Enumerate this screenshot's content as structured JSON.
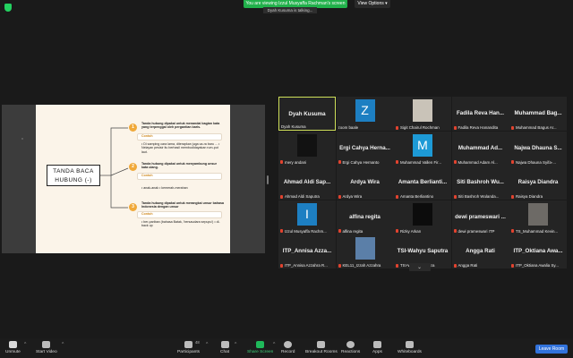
{
  "banner": {
    "viewing_text": "You are viewing Izzul Musyaffa Rachman's screen",
    "view_options": "View Options ▾",
    "talking": "Dyah Kusuma is talking..."
  },
  "slide": {
    "root_line1": "TANDA BACA",
    "root_line2": "HUBUNG (-)",
    "b1_num": "1",
    "b1_desc": "Tanda hubung dipakai untuk menandai bagian kata yang terpenggal oleh pergantian baris.",
    "b1_contoh": "Contoh",
    "b1_ex": "• Di samping cara lama, diterapkan juga ca-ra baru ...  • Nelayan pesisir itu berhasil membudidayakan rum-put laut.",
    "b2_num": "2",
    "b2_desc": "Tanda hubung dipakai untuk menyambung unsur kata ulang.",
    "b2_contoh": "Contoh",
    "b2_ex": "• anak-anak  • kemerah-merahan",
    "b3_num": "3",
    "b3_desc": "Tanda hubung dipakai untuk merangkai unsur bahasa Indonesia dengan unsur",
    "b3_contoh": "Contoh",
    "b3_ex": "• ber-pariban (bahasa Batak, 'bersaudara sepupu')  • di-back up"
  },
  "participants": [
    {
      "name": "Dyah Kusuma",
      "label": "Dyah Kusuma",
      "muted": false,
      "active": true
    },
    {
      "name": "",
      "label": "zoom baale",
      "muted": false,
      "avatar": "letter",
      "letter": "Z",
      "color": "#1d7fc2"
    },
    {
      "name": "",
      "label": "Sigit Chairul Rochman",
      "muted": true,
      "avatar": "photo",
      "color": "#c9c3b8"
    },
    {
      "name": "Fadila Reva Han...",
      "label": "Fadila Reva Hanandita",
      "muted": true
    },
    {
      "name": "Muhammad Bag...",
      "label": "Muhammad Bagus Ar...",
      "muted": true
    },
    {
      "name": "",
      "label": "mery andani",
      "muted": true,
      "avatar": "photo",
      "color": "#121212"
    },
    {
      "name": "Ergi Cahya Herna...",
      "label": "Ergi Cahya Hernanto",
      "muted": true
    },
    {
      "name": "",
      "label": "Muhammad Vallen Fir...",
      "muted": true,
      "avatar": "letter",
      "letter": "M",
      "color": "#1d9ad6"
    },
    {
      "name": "Muhammad Ad...",
      "label": "Muhammad Adam Al...",
      "muted": true
    },
    {
      "name": "Najwa Dhauna S...",
      "label": "Najwa Dhauna Syifa-...",
      "muted": true
    },
    {
      "name": "Ahmad Aldi Sap...",
      "label": "Ahmad Aldi Saputra",
      "muted": true
    },
    {
      "name": "Ardya Wira",
      "label": "Ardya Wira",
      "muted": true
    },
    {
      "name": "Amanta Berlianti...",
      "label": "Amanta Berliantino",
      "muted": true
    },
    {
      "name": "Siti Bashroh Wu...",
      "label": "Siti Bashroh Wulanda...",
      "muted": true
    },
    {
      "name": "Raisya Diandra",
      "label": "Raisya Diandra",
      "muted": true
    },
    {
      "name": "",
      "label": "Izzul Musyaffa Rachm...",
      "muted": true,
      "avatar": "letter",
      "letter": "I",
      "color": "#1d7fc2"
    },
    {
      "name": "alfina regita",
      "label": "alfina regita",
      "muted": true
    },
    {
      "name": "",
      "label": "Rizky Arkan",
      "muted": true,
      "avatar": "photo",
      "color": "#0c0c0c"
    },
    {
      "name": "dewi prameswari ...",
      "label": "dewi prameswari ITP",
      "muted": true
    },
    {
      "name": "",
      "label": "TS_Muhammad Kevin...",
      "muted": true,
      "avatar": "photo",
      "color": "#6d6a66"
    },
    {
      "name": "ITP_Annisa Azza...",
      "label": "ITP_Annisa Azzahra R...",
      "muted": true
    },
    {
      "name": "",
      "label": "KEL11_Izzah Azzahra",
      "muted": true,
      "avatar": "photo",
      "color": "#5b7fa8"
    },
    {
      "name": "TSI-Wahyu Saputra",
      "label": "TSI-Wahyu Saputra",
      "muted": true
    },
    {
      "name": "Angga Rati",
      "label": "Angga Rati",
      "muted": true
    },
    {
      "name": "ITP_Oktiana Awa...",
      "label": "ITP_Oktiana Awalia Sy...",
      "muted": true
    }
  ],
  "toolbar": {
    "unmute": "Unmute",
    "start_video": "Start Video",
    "participants": "Participants",
    "participant_count": "48",
    "chat": "Chat",
    "share_screen": "Share Screen",
    "record": "Record",
    "breakout": "Breakout Rooms",
    "reactions": "Reactions",
    "apps": "Apps",
    "whiteboards": "Whiteboards",
    "leave": "Leave Room"
  },
  "colors": {
    "accent_green": "#21b14b",
    "leave_blue": "#3273dc",
    "active_border": "#cfe05a",
    "number_orange": "#f0a93a"
  }
}
